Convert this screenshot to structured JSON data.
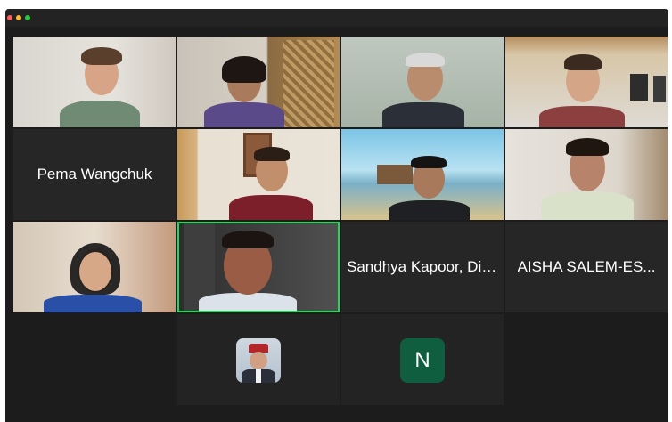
{
  "window": {
    "traffic_lights": [
      {
        "name": "close",
        "color": "#ff5f57"
      },
      {
        "name": "minimize",
        "color": "#febc2e"
      },
      {
        "name": "maximize",
        "color": "#28c840"
      }
    ]
  },
  "gallery": {
    "active_speaker_color": "#23d959",
    "name_tiles": [
      {
        "id": "pema",
        "label": "Pema Wangchuk"
      },
      {
        "id": "sandhya",
        "label": "Sandhya Kapoor, Dir..."
      },
      {
        "id": "aisha",
        "label": "AISHA  SALEM-ES..."
      }
    ],
    "avatar_tiles": [
      {
        "id": "photo-avatar",
        "type": "photo"
      },
      {
        "id": "letter-avatar",
        "type": "initial",
        "initial": "N",
        "color": "#0f5e3f"
      }
    ]
  }
}
